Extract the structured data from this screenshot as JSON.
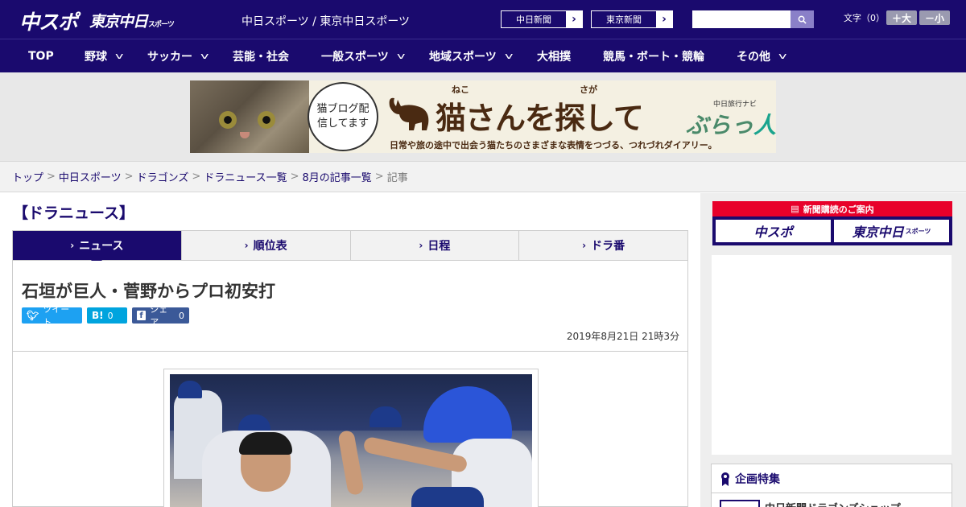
{
  "header": {
    "logo_main": "中スポ",
    "logo_tokyo": "東京中日",
    "logo_tokyo_small": "スポーツ",
    "site_title": "中日スポーツ / 東京中日スポーツ",
    "paper_buttons": [
      {
        "label": "中日新聞"
      },
      {
        "label": "東京新聞"
      }
    ],
    "search_placeholder": "",
    "font_size_label": "文字（0）",
    "font_larger": "＋大",
    "font_smaller": "－小"
  },
  "nav": {
    "items": [
      {
        "label": "TOP",
        "dropdown": false
      },
      {
        "label": "野球",
        "dropdown": true
      },
      {
        "label": "サッカー",
        "dropdown": true
      },
      {
        "label": "芸能・社会",
        "dropdown": false
      },
      {
        "label": "一般スポーツ",
        "dropdown": true
      },
      {
        "label": "地域スポーツ",
        "dropdown": true
      },
      {
        "label": "大相撲",
        "dropdown": false
      },
      {
        "label": "競馬・ボート・競輪",
        "dropdown": false
      },
      {
        "label": "その他",
        "dropdown": true
      }
    ]
  },
  "banner": {
    "speech": "猫ブログ配信してます",
    "title": "猫さんを探して",
    "ruby_1": "ねこ",
    "ruby_2": "さが",
    "subtitle": "日常や旅の途中で出会う猫たちのさまざまな表情をつづる、つれづれダイアリー。",
    "navi_small": "中日旅行ナビ",
    "navi_logo": "ぶらっ",
    "navi_logo_accent": "人"
  },
  "breadcrumb": {
    "items": [
      "トップ",
      "中日スポーツ",
      "ドラゴンズ",
      "ドラニュース一覧",
      "8月の記事一覧"
    ],
    "current": "記事",
    "separator": ">"
  },
  "section": {
    "title": "【ドラニュース】"
  },
  "tabs": [
    {
      "label": "ニュース",
      "active": true
    },
    {
      "label": "順位表",
      "active": false
    },
    {
      "label": "日程",
      "active": false
    },
    {
      "label": "ドラ番",
      "active": false
    }
  ],
  "article": {
    "headline": "石垣が巨人・菅野からプロ初安打",
    "share": {
      "tweet_label": "ツイート",
      "hatena_icon": "B!",
      "hatena_count": "0",
      "facebook_label": "シェア",
      "facebook_count": "0"
    },
    "date": "2019年8月21日 21時3分"
  },
  "sidebar": {
    "subscribe_title": "新聞購読のご案内",
    "subscribe_buttons": [
      "中スポ",
      "東京中日"
    ],
    "subscribe_small": "スポーツ",
    "feature_title": "企画特集",
    "feature_item": "中日新聞ドラゴンズショップ"
  },
  "colors": {
    "brand_navy": "#1a0a6e",
    "accent_red": "#e8002a",
    "twitter": "#1da1f2",
    "hatena": "#00a4de",
    "facebook": "#3b5998"
  }
}
